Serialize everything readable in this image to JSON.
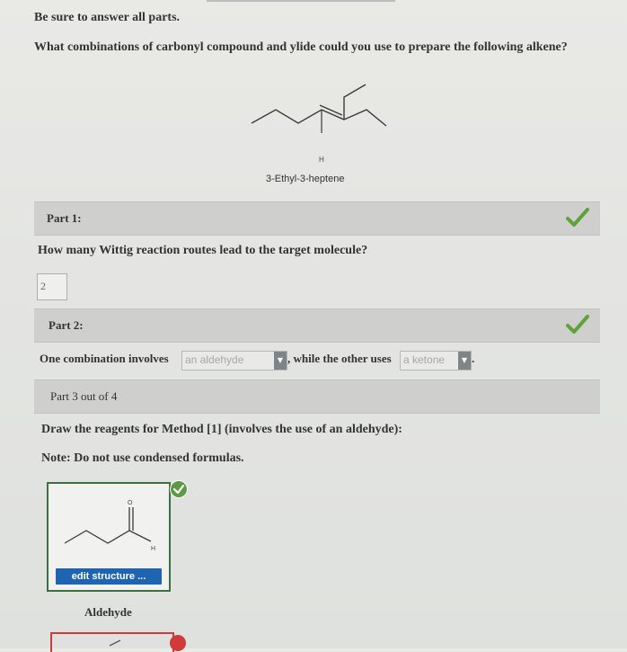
{
  "instruction": "Be sure to answer all parts.",
  "question": "What combinations of carbonyl compound and ylide could you use to prepare the following alkene?",
  "molecule": {
    "h_label": "H",
    "name": "3-Ethyl-3-heptene"
  },
  "part1": {
    "header": "Part 1:",
    "question": "How many Wittig reaction routes lead to the target molecule?",
    "answer": "2",
    "status": "check-icon"
  },
  "part2": {
    "header": "Part 2:",
    "sentence_start": "One combination involves",
    "select1_value": "an aldehyde",
    "sentence_mid": ", while the other uses",
    "select2_value": "a ketone",
    "sentence_end": ".",
    "status": "check-icon"
  },
  "part3": {
    "header": "Part 3 out of 4",
    "instruction": "Draw the reagents for Method [1] (involves the use of an aldehyde):",
    "note": "Note: Do not use condensed formulas.",
    "structure": {
      "o_label": "O",
      "h_label": "H"
    },
    "edit_button": "edit structure ...",
    "caption": "Aldehyde"
  },
  "colors": {
    "check_green": "#5fa23a",
    "button_blue": "#1e64b0",
    "error_red": "#d13a3a"
  }
}
